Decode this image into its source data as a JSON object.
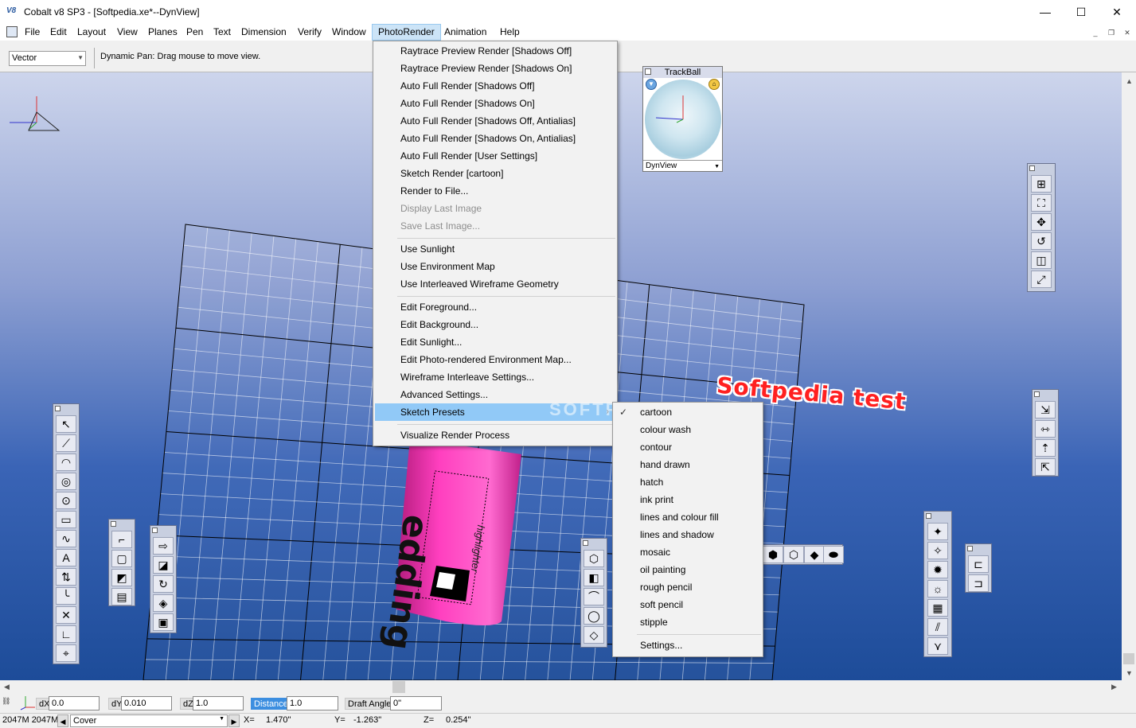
{
  "window": {
    "logo": "V8",
    "title": "Cobalt v8 SP3 - [Softpedia.xe*--DynView]",
    "minimize": "—",
    "maximize": "☐",
    "close": "✕"
  },
  "menubar": {
    "items": [
      "File",
      "Edit",
      "Layout",
      "View",
      "Planes",
      "Pen",
      "Text",
      "Dimension",
      "Verify",
      "Window",
      "PhotoRender",
      "Animation",
      "Help"
    ],
    "mdi_min": "_",
    "mdi_restore": "❐",
    "mdi_close": "✕"
  },
  "toolbar": {
    "mode": "Vector",
    "status_message": "Dynamic Pan: Drag mouse to move view."
  },
  "photorender_menu": {
    "items": [
      {
        "label": "Raytrace Preview Render [Shadows Off]"
      },
      {
        "label": "Raytrace Preview Render [Shadows On]"
      },
      {
        "label": "Auto Full Render [Shadows Off]"
      },
      {
        "label": "Auto Full Render [Shadows On]"
      },
      {
        "label": "Auto Full Render [Shadows Off, Antialias]"
      },
      {
        "label": "Auto Full Render [Shadows On, Antialias]"
      },
      {
        "label": "Auto Full Render [User Settings]"
      },
      {
        "label": "Sketch Render [cartoon]"
      },
      {
        "label": "Render to File..."
      },
      {
        "label": "Display Last Image"
      },
      {
        "label": "Save Last Image..."
      },
      {
        "label": "Use Sunlight"
      },
      {
        "label": "Use Environment Map"
      },
      {
        "label": "Use Interleaved Wireframe Geometry"
      },
      {
        "label": "Edit Foreground..."
      },
      {
        "label": "Edit Background..."
      },
      {
        "label": "Edit Sunlight..."
      },
      {
        "label": "Edit Photo-rendered Environment Map..."
      },
      {
        "label": "Wireframe Interleave Settings..."
      },
      {
        "label": "Advanced Settings..."
      },
      {
        "label": "Sketch Presets"
      },
      {
        "label": "Visualize Render Process"
      }
    ]
  },
  "sketch_presets_menu": {
    "items": [
      {
        "label": "cartoon",
        "checked": true
      },
      {
        "label": "colour wash"
      },
      {
        "label": "contour"
      },
      {
        "label": "hand drawn"
      },
      {
        "label": "hatch"
      },
      {
        "label": "ink print"
      },
      {
        "label": "lines and colour fill"
      },
      {
        "label": "lines and shadow"
      },
      {
        "label": "mosaic"
      },
      {
        "label": "oil painting"
      },
      {
        "label": "rough pencil"
      },
      {
        "label": "soft pencil"
      },
      {
        "label": "stipple"
      },
      {
        "label": "Settings..."
      }
    ],
    "check_glyph": "✓",
    "submenu_arrow": "›"
  },
  "trackball": {
    "title": "TrackBall",
    "view": "DynView"
  },
  "viewport": {
    "annotation_text": "Softpedia test",
    "watermark": "SOFTPEDIA",
    "product_label": "edding",
    "product_sublabel": "highlighter",
    "grid_color": "#000000",
    "product_color": "#ff2fb4"
  },
  "input_row": {
    "dx_label": "dX",
    "dx_value": "0.0",
    "dy_label": "dY",
    "dy_value": "0.010",
    "dz_label": "dZ",
    "dz_value": "1.0",
    "distance_label": "Distance",
    "distance_value": "1.0",
    "draft_label": "Draft Angle",
    "draft_value": "0\""
  },
  "statusbar": {
    "memory": "2047M 2047M",
    "layer": "Cover",
    "x_label": "X=",
    "x_value": "1.470\"",
    "y_label": "Y=",
    "y_value": "-1.263\"",
    "z_label": "Z=",
    "z_value": "0.254\""
  },
  "icons": {
    "scroll_up": "▲",
    "scroll_down": "▼",
    "scroll_left": "◀",
    "scroll_right": "▶",
    "dropdown": "▼"
  }
}
